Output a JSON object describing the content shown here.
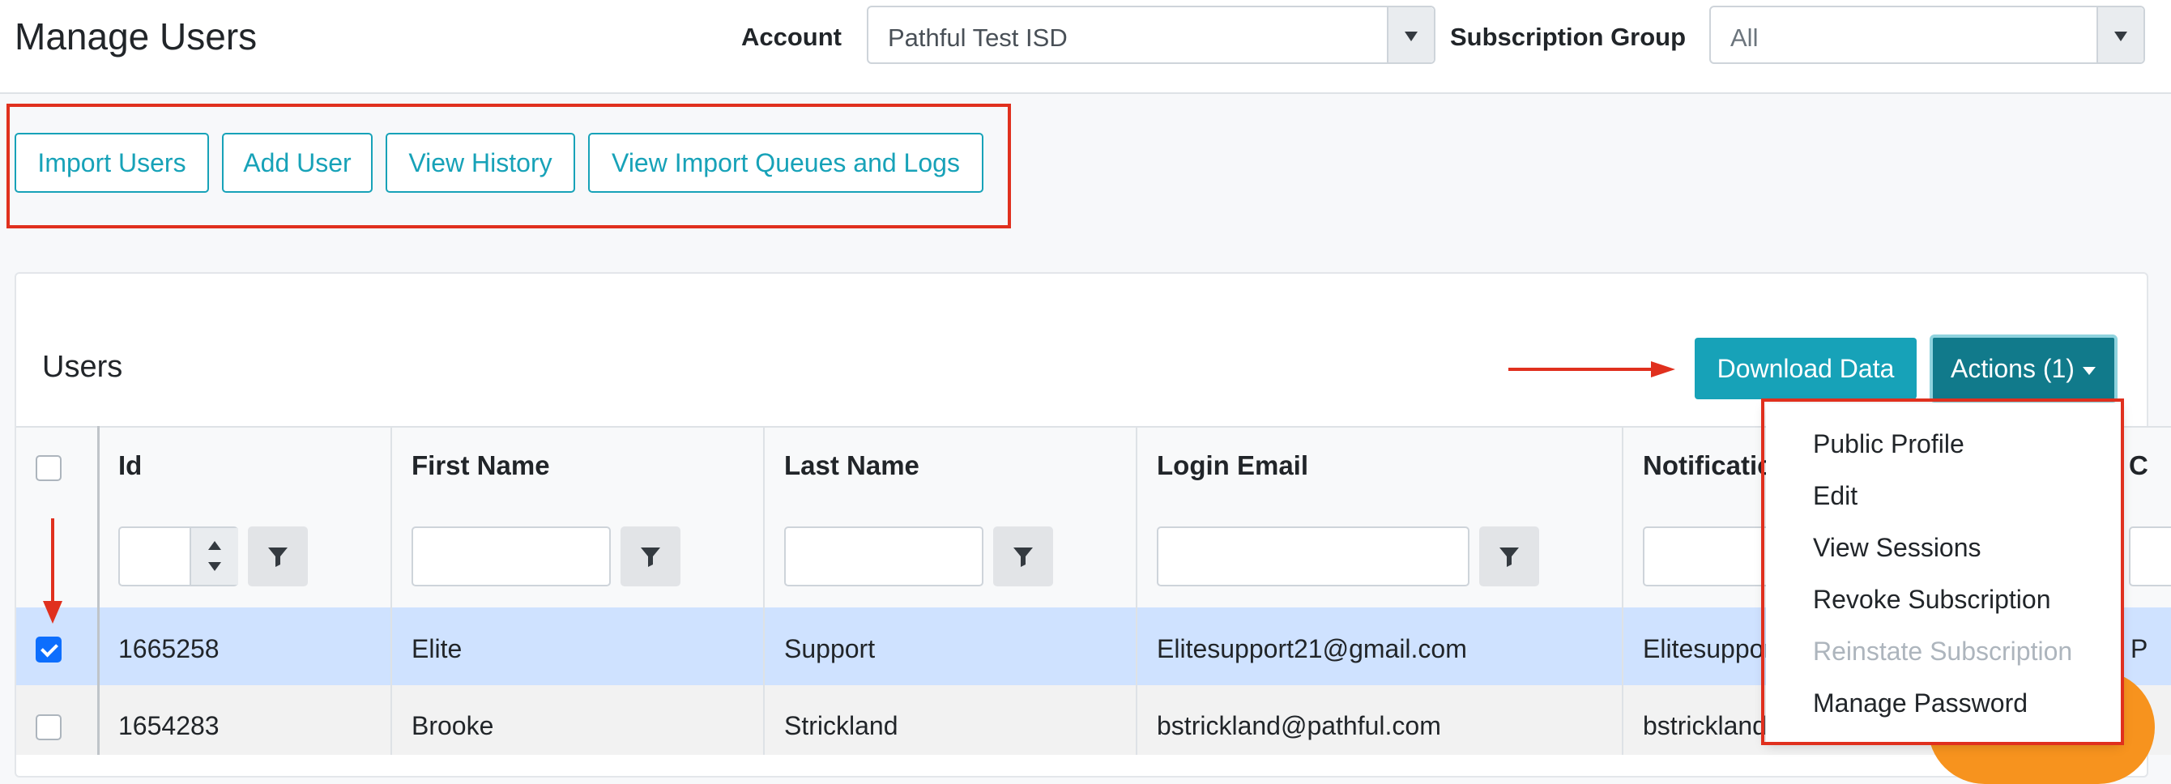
{
  "header": {
    "title": "Manage Users",
    "account_label": "Account",
    "account_value": "Pathful Test ISD",
    "group_label": "Subscription Group",
    "group_value": "All"
  },
  "toolbar": {
    "import_users": "Import Users",
    "add_user": "Add User",
    "view_history": "View History",
    "view_queues": "View Import Queues and Logs"
  },
  "users_card": {
    "title": "Users",
    "download_label": "Download Data",
    "actions_label": "Actions (1)"
  },
  "table": {
    "columns": [
      "Id",
      "First Name",
      "Last Name",
      "Login Email",
      "Notificatio",
      "C"
    ],
    "rows": [
      {
        "checked": true,
        "id": "1665258",
        "first": "Elite",
        "last": "Support",
        "email": "Elitesupport21@gmail.com",
        "notify": "Elitesuppor",
        "extra": "P"
      },
      {
        "checked": false,
        "id": "1654283",
        "first": "Brooke",
        "last": "Strickland",
        "email": "bstrickland@pathful.com",
        "notify": "bstrickland",
        "extra": ""
      }
    ]
  },
  "actions_menu": {
    "items": [
      {
        "label": "Public Profile",
        "disabled": false
      },
      {
        "label": "Edit",
        "disabled": false
      },
      {
        "label": "View Sessions",
        "disabled": false
      },
      {
        "label": "Revoke Subscription",
        "disabled": false
      },
      {
        "label": "Reinstate Subscription",
        "disabled": true
      },
      {
        "label": "Manage Password",
        "disabled": false
      }
    ]
  },
  "colors": {
    "accent": "#17a2b8",
    "annotation": "#e0301e",
    "selected_row": "#cfe2ff"
  }
}
